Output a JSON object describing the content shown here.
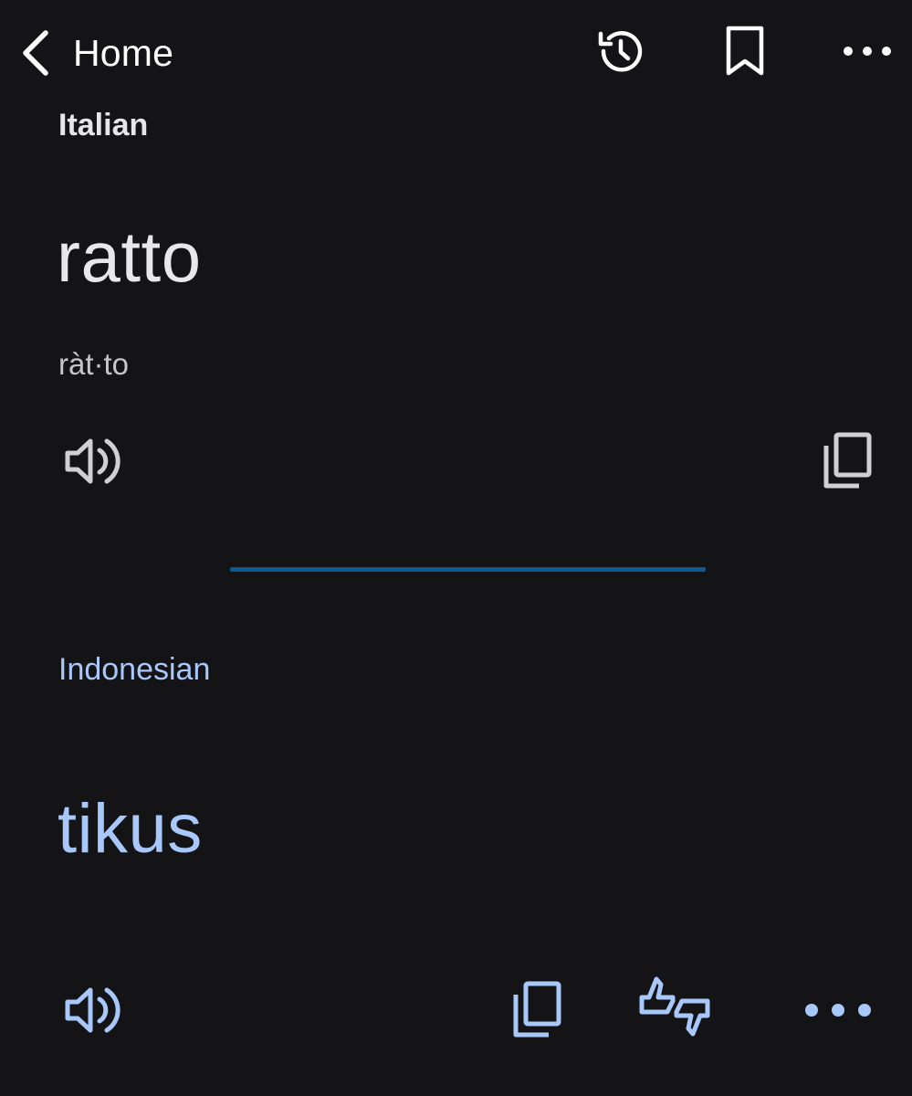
{
  "header": {
    "back_label": "Home",
    "icons": [
      "chevron-left-icon",
      "history-icon",
      "bookmark-icon",
      "more-horizontal-icon"
    ]
  },
  "source": {
    "language": "Italian",
    "word": "ratto",
    "phonetic": "ràt·to"
  },
  "target": {
    "language": "Indonesian",
    "word": "tikus"
  },
  "colors": {
    "background": "#141417",
    "accent": "#a8c7fa",
    "divider": "#0b5a8e",
    "text": "#e3e3e6"
  }
}
